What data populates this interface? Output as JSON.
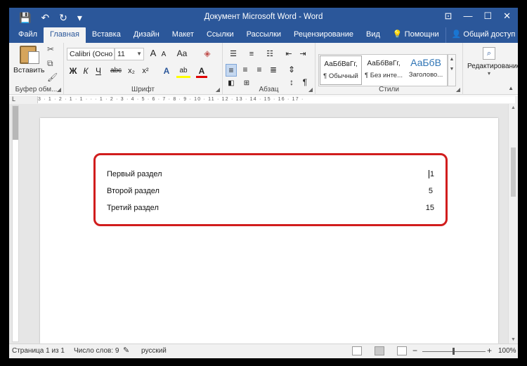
{
  "window": {
    "title": "Документ Microsoft Word - Word",
    "controls": {
      "restore_ribbon": "⊡",
      "minimize": "—",
      "maximize": "☐",
      "close": "✕"
    }
  },
  "quick_access": {
    "save_icon": "💾",
    "undo_icon": "↶",
    "redo_icon": "↻",
    "customize_icon": "▾"
  },
  "tabs": [
    {
      "label": "Файл",
      "active": false
    },
    {
      "label": "Главная",
      "active": true
    },
    {
      "label": "Вставка",
      "active": false
    },
    {
      "label": "Дизайн",
      "active": false
    },
    {
      "label": "Макет",
      "active": false
    },
    {
      "label": "Ссылки",
      "active": false
    },
    {
      "label": "Рассылки",
      "active": false
    },
    {
      "label": "Рецензирование",
      "active": false
    },
    {
      "label": "Вид",
      "active": false
    }
  ],
  "help": {
    "label": "Помощни"
  },
  "share": {
    "label": "Общий доступ"
  },
  "ribbon": {
    "clipboard": {
      "paste_label": "Вставить",
      "group_label": "Буфер обм..."
    },
    "font": {
      "font_name": "Calibri (Осно",
      "font_size": "11",
      "grow": "A",
      "shrink": "A",
      "case": "Aa",
      "bold": "Ж",
      "italic": "К",
      "underline": "Ч",
      "strike": "abc",
      "sub": "x₂",
      "sup": "x²",
      "effects": "A",
      "highlight": "ab",
      "color": "A",
      "group_label": "Шрифт"
    },
    "paragraph": {
      "group_label": "Абзац",
      "pilcrow": "¶",
      "sort": "↕"
    },
    "styles": {
      "items": [
        {
          "sample": "АаБбВвГг,",
          "name": "¶ Обычный",
          "selected": true
        },
        {
          "sample": "АаБбВвГг,",
          "name": "¶ Без инте...",
          "selected": false
        },
        {
          "sample": "АаБбВ",
          "name": "Заголово...",
          "selected": false
        }
      ],
      "group_label": "Стили"
    },
    "editing": {
      "label": "Редактирование",
      "icon": "⌕"
    }
  },
  "ruler": {
    "ticks": "3 · 1 · 2 · 1 · 1 · · · 1 · 2 · 3 · 4 · 5 · 6 · 7 · 8 · 9 · 10 · 11 · 12 · 13 · 14 · 15 · 16 · 17 ·"
  },
  "document": {
    "toc": [
      {
        "title": "Первый раздел",
        "page": "1"
      },
      {
        "title": "Второй раздел",
        "page": "5"
      },
      {
        "title": "Третий раздел",
        "page": "15"
      }
    ]
  },
  "statusbar": {
    "page": "Страница 1 из 1",
    "words": "Число слов: 9",
    "language": "русский",
    "zoom": "100%",
    "zoom_out": "−",
    "zoom_in": "+"
  },
  "colors": {
    "accent": "#2b579a",
    "highlight_border": "#d11d1d"
  }
}
